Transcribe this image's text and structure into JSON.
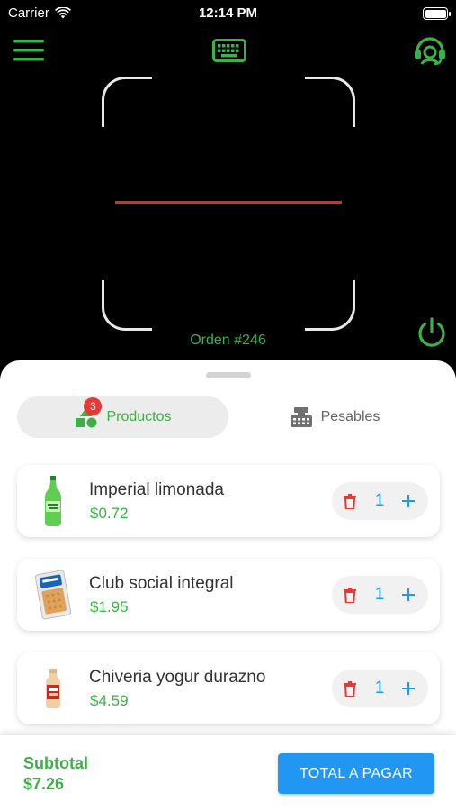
{
  "status_bar": {
    "carrier": "Carrier",
    "time": "12:14 PM"
  },
  "icons": {
    "menu": "menu-icon",
    "keyboard": "keyboard-icon",
    "support": "headset-icon",
    "power": "power-icon"
  },
  "scanner": {
    "order_label": "Orden #246"
  },
  "tabs": [
    {
      "label": "Productos",
      "badge": "3",
      "icon": "shapes-icon",
      "active": true
    },
    {
      "label": "Pesables",
      "icon": "scale-icon",
      "active": false
    }
  ],
  "products": [
    {
      "name": "Imperial limonada",
      "price": "$0.72",
      "qty": "1"
    },
    {
      "name": "Club social integral",
      "price": "$1.95",
      "qty": "1"
    },
    {
      "name": "Chiveria yogur durazno",
      "price": "$4.59",
      "qty": "1"
    }
  ],
  "footer": {
    "subtotal_label": "Subtotal",
    "subtotal_value": "$7.26",
    "pay_button": "TOTAL A PAGAR"
  },
  "colors": {
    "accent_green": "#3eb049",
    "blue": "#2196f3",
    "scan_line": "#d2302a",
    "badge_red": "#e53935"
  }
}
